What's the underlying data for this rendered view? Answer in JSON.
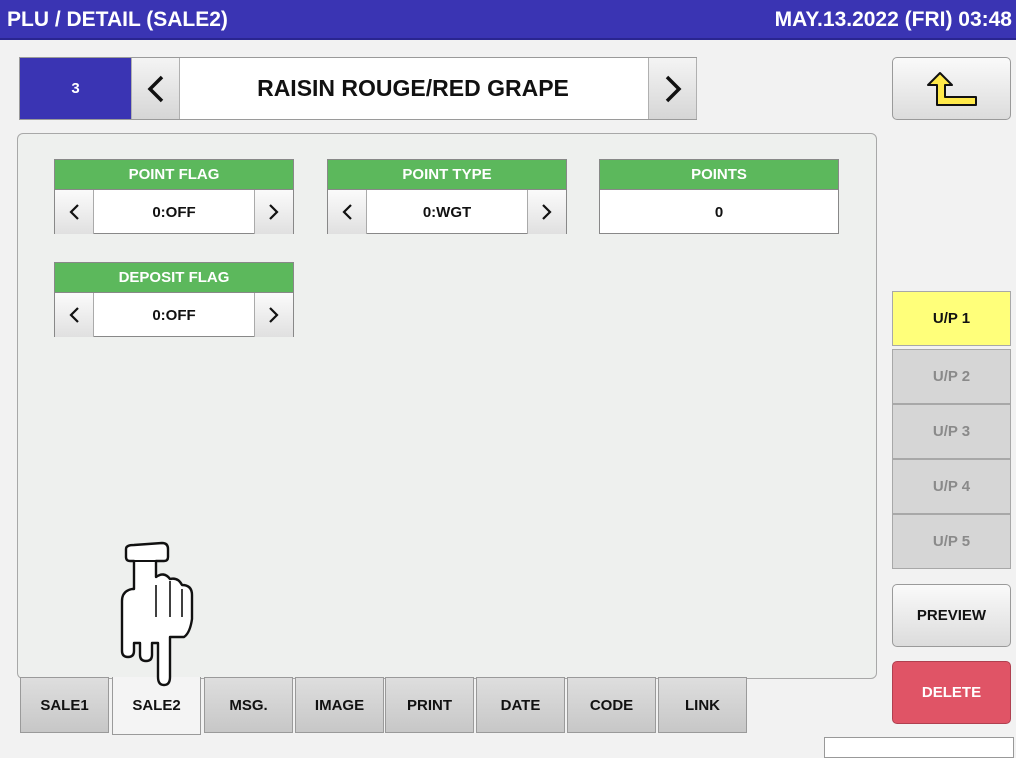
{
  "header": {
    "title": "PLU / DETAIL (SALE2)",
    "datetime": "MAY.13.2022 (FRI)  03:48"
  },
  "plu": {
    "number": "3",
    "name": "RAISIN ROUGE/RED GRAPE",
    "prev_icon": "chevron-left-icon",
    "next_icon": "chevron-right-icon"
  },
  "back_icon": "return-arrow-icon",
  "fields": {
    "point_flag": {
      "label": "POINT FLAG",
      "value": "0:OFF"
    },
    "point_type": {
      "label": "POINT TYPE",
      "value": "0:WGT"
    },
    "points": {
      "label": "POINTS",
      "value": "0"
    },
    "deposit_flag": {
      "label": "DEPOSIT FLAG",
      "value": "0:OFF"
    }
  },
  "tabs": [
    {
      "label": "SALE1"
    },
    {
      "label": "SALE2"
    },
    {
      "label": "MSG."
    },
    {
      "label": "IMAGE"
    },
    {
      "label": "PRINT"
    },
    {
      "label": "DATE"
    },
    {
      "label": "CODE"
    },
    {
      "label": "LINK"
    }
  ],
  "active_tab": "SALE2",
  "unit_prices": [
    {
      "label": "U/P 1"
    },
    {
      "label": "U/P 2"
    },
    {
      "label": "U/P 3"
    },
    {
      "label": "U/P 4"
    },
    {
      "label": "U/P 5"
    }
  ],
  "active_unit_price": "U/P 1",
  "buttons": {
    "preview": "PREVIEW",
    "delete": "DELETE"
  },
  "colors": {
    "title_bar": "#3a34b3",
    "field_header": "#5cb85c",
    "active_unit_price": "#ffff7a",
    "delete": "#e05466"
  },
  "cursor_icon": "pointing-hand-icon"
}
